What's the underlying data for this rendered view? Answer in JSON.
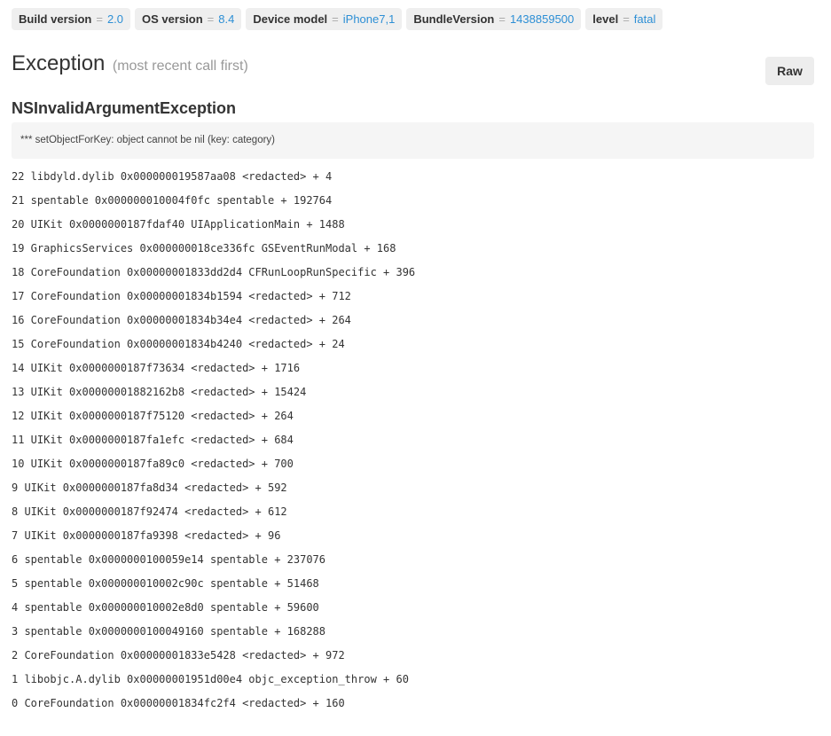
{
  "tags": [
    {
      "key": "Build version",
      "value": "2.0"
    },
    {
      "key": "OS version",
      "value": "8.4"
    },
    {
      "key": "Device model",
      "value": "iPhone7,1"
    },
    {
      "key": "BundleVersion",
      "value": "1438859500"
    },
    {
      "key": "level",
      "value": "fatal"
    }
  ],
  "tag_separator": "=",
  "heading": {
    "title": "Exception",
    "subtitle": "(most recent call first)"
  },
  "raw_button": "Raw",
  "exception": {
    "name": "NSInvalidArgumentException",
    "message": "*** setObjectForKey: object cannot be nil (key: category)"
  },
  "frames": [
    "22 libdyld.dylib 0x000000019587aa08 <redacted> + 4",
    "21 spentable 0x000000010004f0fc spentable + 192764",
    "20 UIKit 0x0000000187fdaf40 UIApplicationMain + 1488",
    "19 GraphicsServices 0x000000018ce336fc GSEventRunModal + 168",
    "18 CoreFoundation 0x00000001833dd2d4 CFRunLoopRunSpecific + 396",
    "17 CoreFoundation 0x00000001834b1594 <redacted> + 712",
    "16 CoreFoundation 0x00000001834b34e4 <redacted> + 264",
    "15 CoreFoundation 0x00000001834b4240 <redacted> + 24",
    "14 UIKit 0x0000000187f73634 <redacted> + 1716",
    "13 UIKit 0x00000001882162b8 <redacted> + 15424",
    "12 UIKit 0x0000000187f75120 <redacted> + 264",
    "11 UIKit 0x0000000187fa1efc <redacted> + 684",
    "10 UIKit 0x0000000187fa89c0 <redacted> + 700",
    "9 UIKit 0x0000000187fa8d34 <redacted> + 592",
    "8 UIKit 0x0000000187f92474 <redacted> + 612",
    "7 UIKit 0x0000000187fa9398 <redacted> + 96",
    "6 spentable 0x0000000100059e14 spentable + 237076",
    "5 spentable 0x000000010002c90c spentable + 51468",
    "4 spentable 0x000000010002e8d0 spentable + 59600",
    "3 spentable 0x0000000100049160 spentable + 168288",
    "2 CoreFoundation 0x00000001833e5428 <redacted> + 972",
    "1 libobjc.A.dylib 0x00000001951d00e4 objc_exception_throw + 60",
    "0 CoreFoundation 0x00000001834fc2f4 <redacted> + 160"
  ]
}
